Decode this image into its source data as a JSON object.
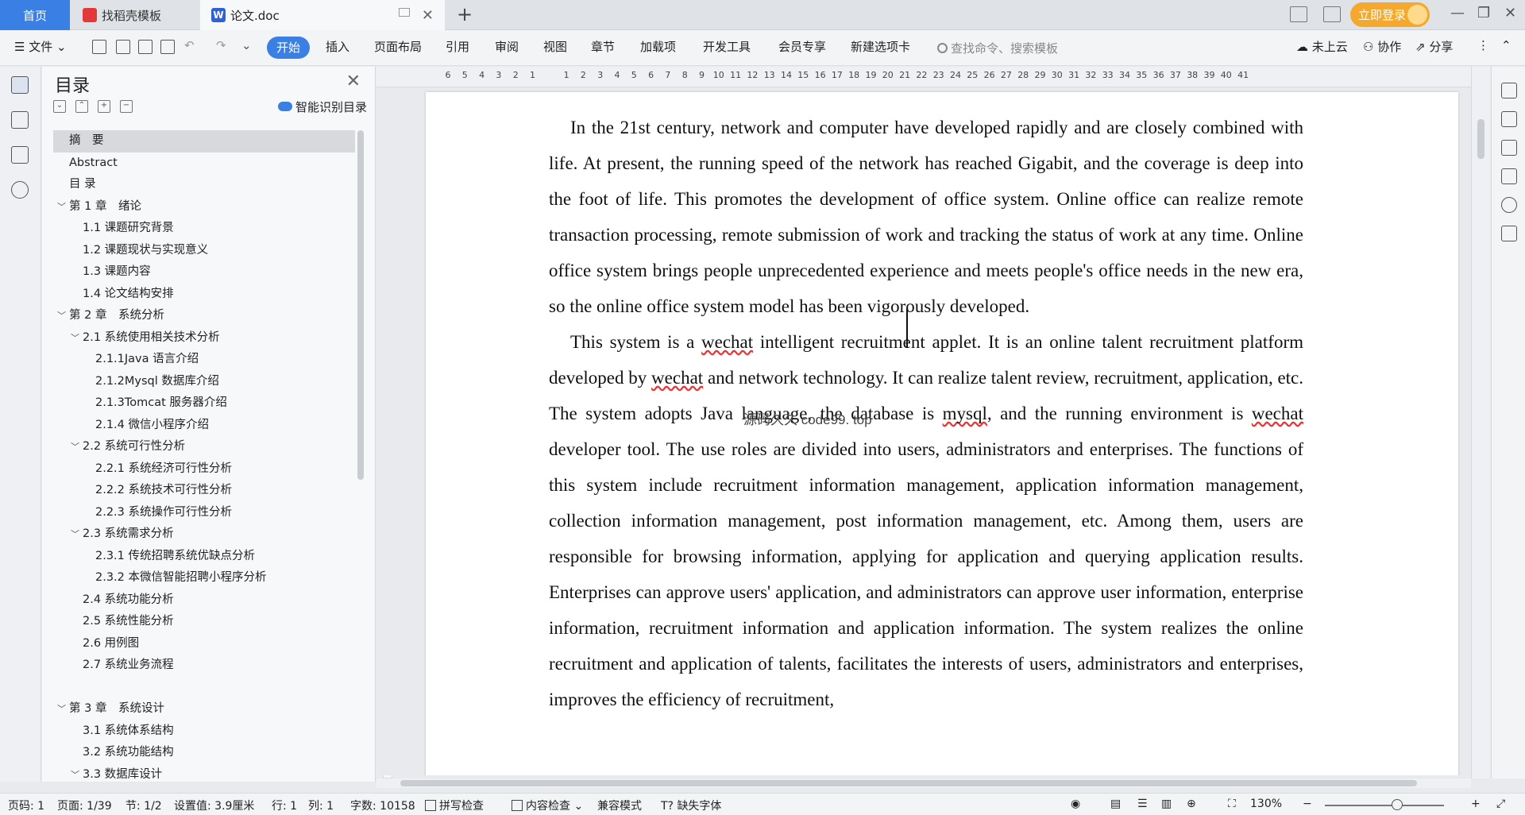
{
  "tabs": {
    "home": "首页",
    "template": "找稻壳模板",
    "doc": "论文.doc",
    "login": "立即登录"
  },
  "ribbon": {
    "file": "文件",
    "items": [
      "开始",
      "插入",
      "页面布局",
      "引用",
      "审阅",
      "视图",
      "章节",
      "加载项",
      "开发工具",
      "会员专享",
      "新建选项卡"
    ],
    "search_placeholder": "查找命令、搜索模板",
    "cloud": "未上云",
    "collab": "协作",
    "share": "分享"
  },
  "toc": {
    "title": "目录",
    "smart": "智能识别目录",
    "items": [
      {
        "label": "摘　要",
        "level": 1,
        "selected": true,
        "chevron": false
      },
      {
        "label": "Abstract",
        "level": 1,
        "chevron": false
      },
      {
        "label": "目  录",
        "level": 1,
        "chevron": false
      },
      {
        "label": "第 1 章　绪论",
        "level": 1,
        "chevron": true
      },
      {
        "label": "1.1 课题研究背景",
        "level": 2,
        "chevron": false
      },
      {
        "label": "1.2 课题现状与实现意义",
        "level": 2,
        "chevron": false
      },
      {
        "label": "1.3 课题内容",
        "level": 2,
        "chevron": false
      },
      {
        "label": "1.4 论文结构安排",
        "level": 2,
        "chevron": false
      },
      {
        "label": "第 2 章　系统分析",
        "level": 1,
        "chevron": true
      },
      {
        "label": "2.1 系统使用相关技术分析",
        "level": 2,
        "chevron": true
      },
      {
        "label": "2.1.1Java 语言介绍",
        "level": 3,
        "chevron": false
      },
      {
        "label": "2.1.2Mysql 数据库介绍",
        "level": 3,
        "chevron": false
      },
      {
        "label": "2.1.3Tomcat 服务器介绍",
        "level": 3,
        "chevron": false
      },
      {
        "label": "2.1.4 微信小程序介绍",
        "level": 3,
        "chevron": false
      },
      {
        "label": "2.2 系统可行性分析",
        "level": 2,
        "chevron": true
      },
      {
        "label": "2.2.1 系统经济可行性分析",
        "level": 3,
        "chevron": false
      },
      {
        "label": "2.2.2 系统技术可行性分析",
        "level": 3,
        "chevron": false
      },
      {
        "label": "2.2.3 系统操作可行性分析",
        "level": 3,
        "chevron": false
      },
      {
        "label": "2.3 系统需求分析",
        "level": 2,
        "chevron": true
      },
      {
        "label": "2.3.1 传统招聘系统优缺点分析",
        "level": 3,
        "chevron": false
      },
      {
        "label": "2.3.2 本微信智能招聘小程序分析",
        "level": 3,
        "chevron": false
      },
      {
        "label": "2.4 系统功能分析",
        "level": 2,
        "chevron": false
      },
      {
        "label": "2.5 系统性能分析",
        "level": 2,
        "chevron": false
      },
      {
        "label": "2.6 用例图",
        "level": 2,
        "chevron": false
      },
      {
        "label": "2.7 系统业务流程",
        "level": 2,
        "chevron": false
      },
      {
        "label": "",
        "level": 1,
        "chevron": false
      },
      {
        "label": "第 3 章　系统设计",
        "level": 1,
        "chevron": true
      },
      {
        "label": "3.1 系统体系结构",
        "level": 2,
        "chevron": false
      },
      {
        "label": "3.2 系统功能结构",
        "level": 2,
        "chevron": false
      },
      {
        "label": "3.3 数据库设计",
        "level": 2,
        "chevron": true
      }
    ]
  },
  "ruler": [
    "6",
    "5",
    "4",
    "3",
    "2",
    "1",
    "",
    "1",
    "2",
    "3",
    "4",
    "5",
    "6",
    "7",
    "8",
    "9",
    "10",
    "11",
    "12",
    "13",
    "14",
    "15",
    "16",
    "17",
    "18",
    "19",
    "20",
    "21",
    "22",
    "23",
    "24",
    "25",
    "26",
    "27",
    "28",
    "29",
    "30",
    "31",
    "32",
    "33",
    "34",
    "35",
    "36",
    "37",
    "38",
    "39",
    "40",
    "41"
  ],
  "document": {
    "p1": "In the 21st century, network and computer have developed rapidly and are closely combined with life. At present, the running speed of the network has reached Gigabit, and the coverage is deep into the foot of life. This promotes the development of office system. Online office can realize remote transaction processing, remote submission of work and tracking the status of work at any time. Online office system brings people unprecedented experience and meets people's office needs in the new era, so the online office system model has been vigorously developed.",
    "p2_a": "This system is a ",
    "p2_w1": "wechat",
    "p2_b": " intelligent recruitment applet. It is an online talent recruitment platform developed by ",
    "p2_w2": "wechat",
    "p2_c": " and network technology. It can realize talent review, recruitment, application, etc. The system adopts Java language, the database is ",
    "p2_w3": "mysql",
    "p2_d": ", and the running environment is ",
    "p2_w4": "wechat",
    "p2_e": " developer tool. The use roles are divided into users, administrators and enterprises. The functions of this system include recruitment information management, application information management, collection information management, post information management, etc. Among them, users are responsible for browsing information, applying for application and querying application results. Enterprises can approve users' application, and administrators can approve user information, enterprise information, recruitment information and application information. The system realizes the online recruitment and application of talents, facilitates the interests of users, administrators and enterprises, improves the efficiency of recruitment,",
    "watermark": "源码久久 code99. top"
  },
  "status": {
    "page_code": "页码: 1",
    "page": "页面: 1/39",
    "section": "节: 1/2",
    "setting": "设置值: 3.9厘米",
    "row": "行: 1",
    "col": "列: 1",
    "words": "字数: 10158",
    "spell": "拼写检查",
    "content": "内容检查",
    "compat": "兼容模式",
    "missing_font": "缺失字体",
    "zoom": "130%"
  }
}
